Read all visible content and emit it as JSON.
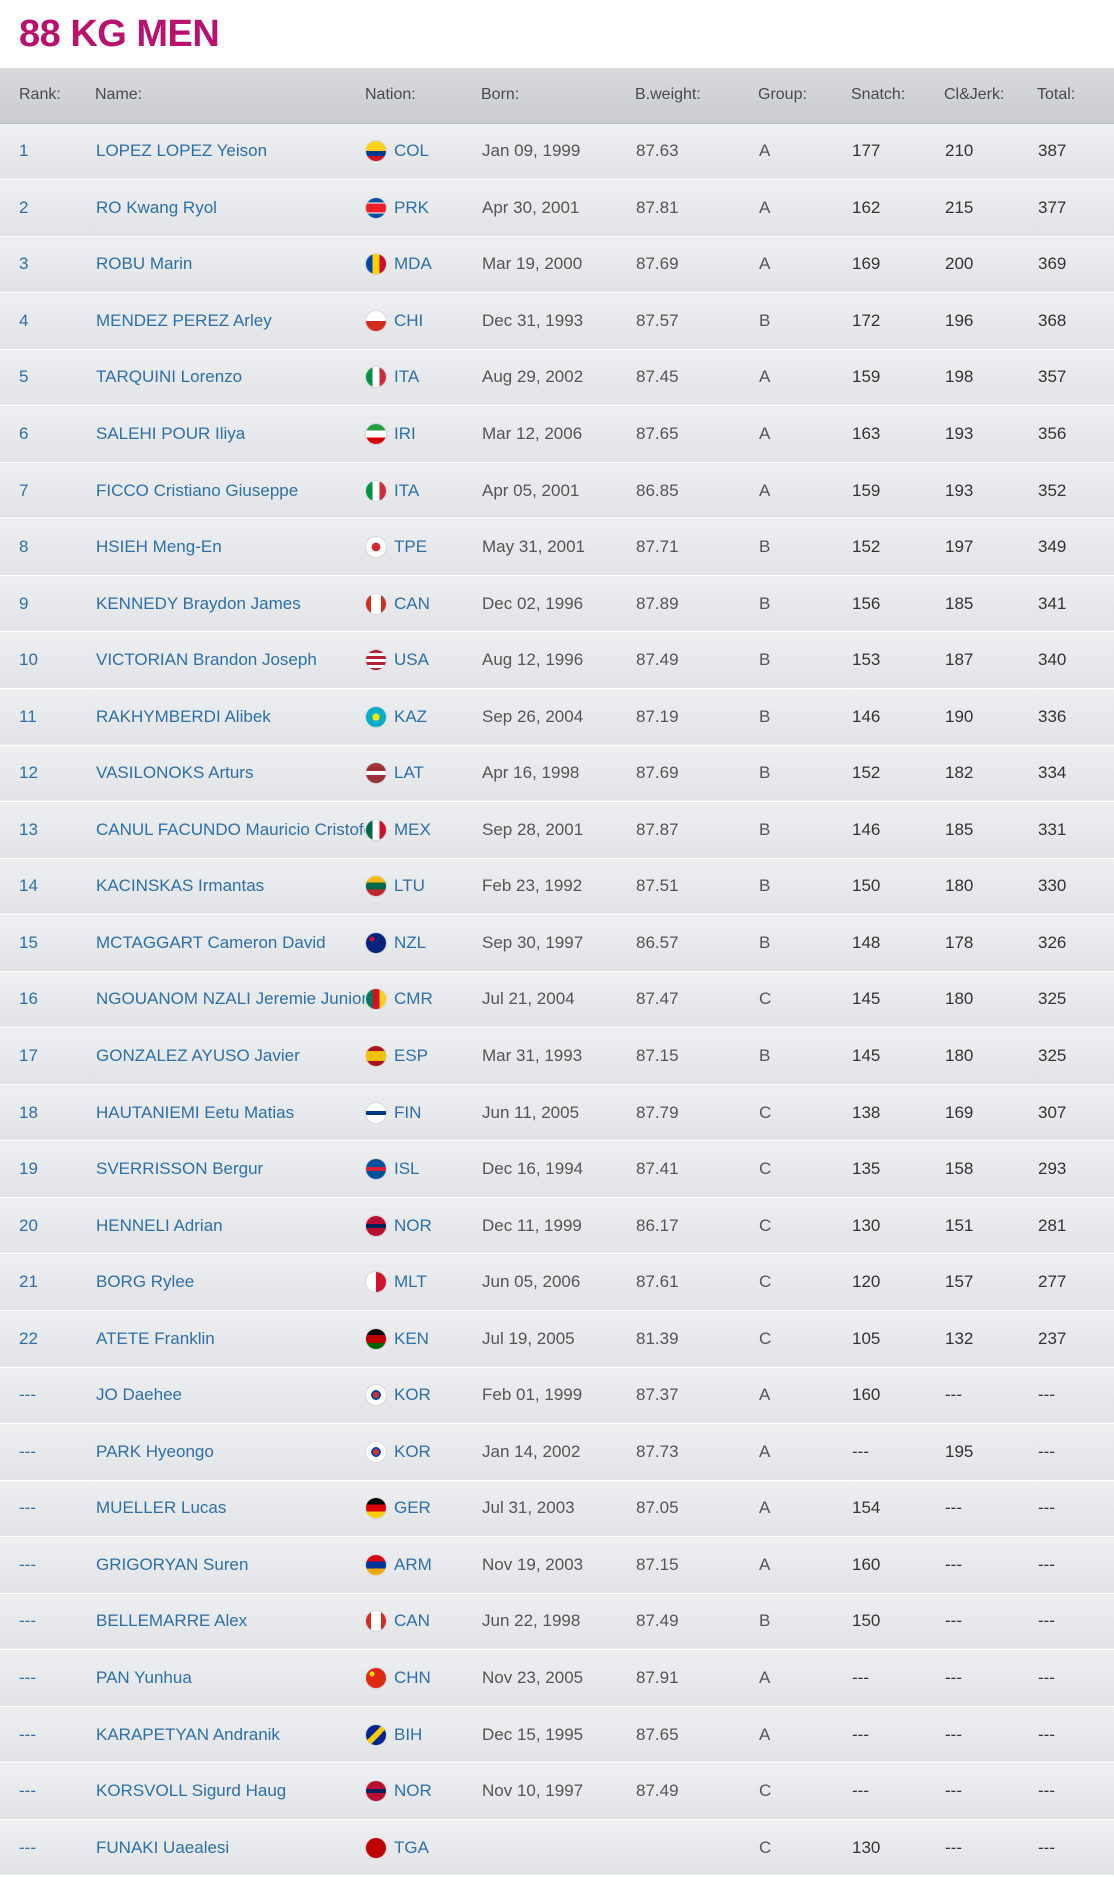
{
  "page_title": "88 KG MEN",
  "headers": [
    "Rank:",
    "Name:",
    "Nation:",
    "Born:",
    "B.weight:",
    "Group:",
    "Snatch:",
    "Cl&Jerk:",
    "Total:"
  ],
  "rows": [
    {
      "rank": "1",
      "name": "LOPEZ LOPEZ Yeison",
      "nation": "COL",
      "born": "Jan 09, 1999",
      "bweight": "87.63",
      "group": "A",
      "snatch": "177",
      "cj": "210",
      "total": "387"
    },
    {
      "rank": "2",
      "name": "RO Kwang Ryol",
      "nation": "PRK",
      "born": "Apr 30, 2001",
      "bweight": "87.81",
      "group": "A",
      "snatch": "162",
      "cj": "215",
      "total": "377"
    },
    {
      "rank": "3",
      "name": "ROBU Marin",
      "nation": "MDA",
      "born": "Mar 19, 2000",
      "bweight": "87.69",
      "group": "A",
      "snatch": "169",
      "cj": "200",
      "total": "369"
    },
    {
      "rank": "4",
      "name": "MENDEZ PEREZ Arley",
      "nation": "CHI",
      "born": "Dec 31, 1993",
      "bweight": "87.57",
      "group": "B",
      "snatch": "172",
      "cj": "196",
      "total": "368"
    },
    {
      "rank": "5",
      "name": "TARQUINI Lorenzo",
      "nation": "ITA",
      "born": "Aug 29, 2002",
      "bweight": "87.45",
      "group": "A",
      "snatch": "159",
      "cj": "198",
      "total": "357"
    },
    {
      "rank": "6",
      "name": "SALEHI POUR Iliya",
      "nation": "IRI",
      "born": "Mar 12, 2006",
      "bweight": "87.65",
      "group": "A",
      "snatch": "163",
      "cj": "193",
      "total": "356"
    },
    {
      "rank": "7",
      "name": "FICCO Cristiano Giuseppe",
      "nation": "ITA",
      "born": "Apr 05, 2001",
      "bweight": "86.85",
      "group": "A",
      "snatch": "159",
      "cj": "193",
      "total": "352"
    },
    {
      "rank": "8",
      "name": "HSIEH Meng-En",
      "nation": "TPE",
      "born": "May 31, 2001",
      "bweight": "87.71",
      "group": "B",
      "snatch": "152",
      "cj": "197",
      "total": "349"
    },
    {
      "rank": "9",
      "name": "KENNEDY Braydon James",
      "nation": "CAN",
      "born": "Dec 02, 1996",
      "bweight": "87.89",
      "group": "B",
      "snatch": "156",
      "cj": "185",
      "total": "341"
    },
    {
      "rank": "10",
      "name": "VICTORIAN Brandon Joseph",
      "nation": "USA",
      "born": "Aug 12, 1996",
      "bweight": "87.49",
      "group": "B",
      "snatch": "153",
      "cj": "187",
      "total": "340"
    },
    {
      "rank": "11",
      "name": "RAKHYMBERDI Alibek",
      "nation": "KAZ",
      "born": "Sep 26, 2004",
      "bweight": "87.19",
      "group": "B",
      "snatch": "146",
      "cj": "190",
      "total": "336"
    },
    {
      "rank": "12",
      "name": "VASILONOKS Arturs",
      "nation": "LAT",
      "born": "Apr 16, 1998",
      "bweight": "87.69",
      "group": "B",
      "snatch": "152",
      "cj": "182",
      "total": "334"
    },
    {
      "rank": "13",
      "name": "CANUL FACUNDO Mauricio Cristofer",
      "nation": "MEX",
      "born": "Sep 28, 2001",
      "bweight": "87.87",
      "group": "B",
      "snatch": "146",
      "cj": "185",
      "total": "331"
    },
    {
      "rank": "14",
      "name": "KACINSKAS Irmantas",
      "nation": "LTU",
      "born": "Feb 23, 1992",
      "bweight": "87.51",
      "group": "B",
      "snatch": "150",
      "cj": "180",
      "total": "330"
    },
    {
      "rank": "15",
      "name": "MCTAGGART Cameron David",
      "nation": "NZL",
      "born": "Sep 30, 1997",
      "bweight": "86.57",
      "group": "B",
      "snatch": "148",
      "cj": "178",
      "total": "326"
    },
    {
      "rank": "16",
      "name": "NGOUANOM NZALI Jeremie Junior",
      "nation": "CMR",
      "born": "Jul 21, 2004",
      "bweight": "87.47",
      "group": "C",
      "snatch": "145",
      "cj": "180",
      "total": "325"
    },
    {
      "rank": "17",
      "name": "GONZALEZ AYUSO Javier",
      "nation": "ESP",
      "born": "Mar 31, 1993",
      "bweight": "87.15",
      "group": "B",
      "snatch": "145",
      "cj": "180",
      "total": "325"
    },
    {
      "rank": "18",
      "name": "HAUTANIEMI Eetu Matias",
      "nation": "FIN",
      "born": "Jun 11, 2005",
      "bweight": "87.79",
      "group": "C",
      "snatch": "138",
      "cj": "169",
      "total": "307"
    },
    {
      "rank": "19",
      "name": "SVERRISSON Bergur",
      "nation": "ISL",
      "born": "Dec 16, 1994",
      "bweight": "87.41",
      "group": "C",
      "snatch": "135",
      "cj": "158",
      "total": "293"
    },
    {
      "rank": "20",
      "name": "HENNELI Adrian",
      "nation": "NOR",
      "born": "Dec 11, 1999",
      "bweight": "86.17",
      "group": "C",
      "snatch": "130",
      "cj": "151",
      "total": "281"
    },
    {
      "rank": "21",
      "name": "BORG Rylee",
      "nation": "MLT",
      "born": "Jun 05, 2006",
      "bweight": "87.61",
      "group": "C",
      "snatch": "120",
      "cj": "157",
      "total": "277"
    },
    {
      "rank": "22",
      "name": "ATETE Franklin",
      "nation": "KEN",
      "born": "Jul 19, 2005",
      "bweight": "81.39",
      "group": "C",
      "snatch": "105",
      "cj": "132",
      "total": "237"
    },
    {
      "rank": "---",
      "name": "JO Daehee",
      "nation": "KOR",
      "born": "Feb 01, 1999",
      "bweight": "87.37",
      "group": "A",
      "snatch": "160",
      "cj": "---",
      "total": "---"
    },
    {
      "rank": "---",
      "name": "PARK Hyeongo",
      "nation": "KOR",
      "born": "Jan 14, 2002",
      "bweight": "87.73",
      "group": "A",
      "snatch": "---",
      "cj": "195",
      "total": "---"
    },
    {
      "rank": "---",
      "name": "MUELLER Lucas",
      "nation": "GER",
      "born": "Jul 31, 2003",
      "bweight": "87.05",
      "group": "A",
      "snatch": "154",
      "cj": "---",
      "total": "---"
    },
    {
      "rank": "---",
      "name": "GRIGORYAN Suren",
      "nation": "ARM",
      "born": "Nov 19, 2003",
      "bweight": "87.15",
      "group": "A",
      "snatch": "160",
      "cj": "---",
      "total": "---"
    },
    {
      "rank": "---",
      "name": "BELLEMARRE Alex",
      "nation": "CAN",
      "born": "Jun 22, 1998",
      "bweight": "87.49",
      "group": "B",
      "snatch": "150",
      "cj": "---",
      "total": "---"
    },
    {
      "rank": "---",
      "name": "PAN Yunhua",
      "nation": "CHN",
      "born": "Nov 23, 2005",
      "bweight": "87.91",
      "group": "A",
      "snatch": "---",
      "cj": "---",
      "total": "---"
    },
    {
      "rank": "---",
      "name": "KARAPETYAN Andranik",
      "nation": "BIH",
      "born": "Dec 15, 1995",
      "bweight": "87.65",
      "group": "A",
      "snatch": "---",
      "cj": "---",
      "total": "---"
    },
    {
      "rank": "---",
      "name": "KORSVOLL Sigurd Haug",
      "nation": "NOR",
      "born": "Nov 10, 1997",
      "bweight": "87.49",
      "group": "C",
      "snatch": "---",
      "cj": "---",
      "total": "---"
    },
    {
      "rank": "---",
      "name": "FUNAKI Uaealesi",
      "nation": "TGA",
      "born": "",
      "bweight": "",
      "group": "C",
      "snatch": "130",
      "cj": "---",
      "total": "---"
    }
  ]
}
